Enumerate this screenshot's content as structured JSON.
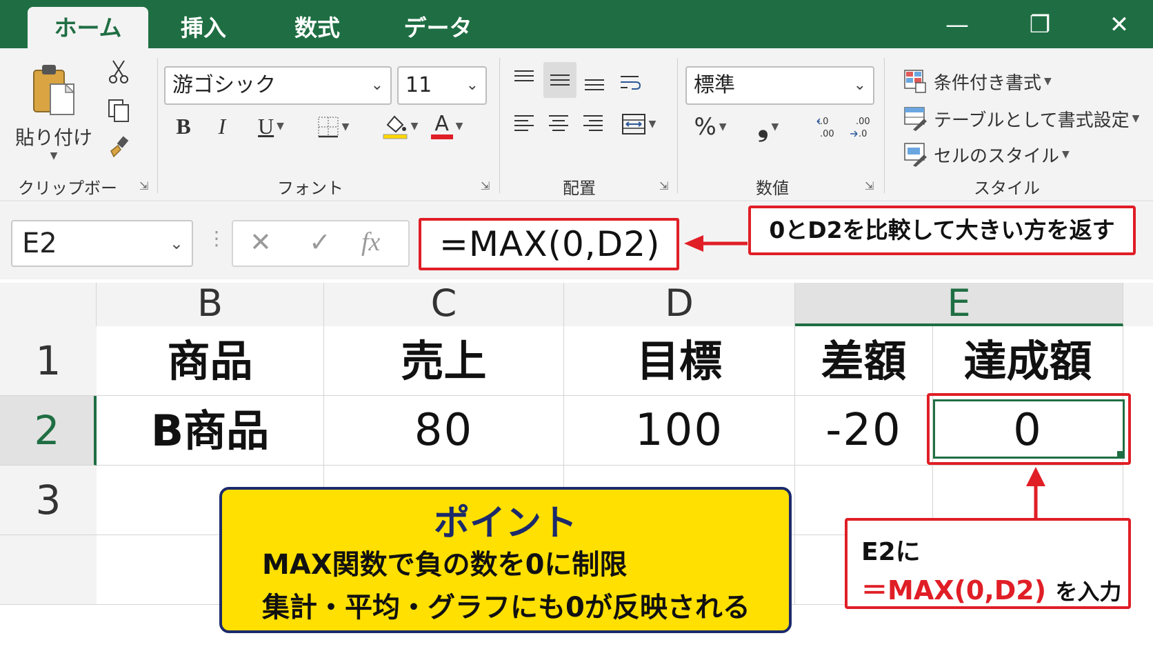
{
  "tabs": [
    {
      "label": "ホーム",
      "active": true
    },
    {
      "label": "挿入",
      "active": false
    },
    {
      "label": "数式",
      "active": false
    },
    {
      "label": "データ",
      "active": false
    }
  ],
  "window_controls": {
    "minimize": "—",
    "maximize": "❐",
    "close": "✕"
  },
  "ribbon": {
    "clipboard": {
      "label": "クリップボード",
      "paste_label": "貼り付け"
    },
    "font": {
      "label": "フォント",
      "font_name": "游ゴシック",
      "font_size": "11",
      "bold": "B",
      "italic": "I",
      "underline": "U",
      "font_color_glyph": "A"
    },
    "alignment": {
      "label": "配置"
    },
    "number": {
      "label": "数値",
      "format": "標準",
      "percent": "%",
      "comma": "❟"
    },
    "styles": {
      "label": "スタイル",
      "items": [
        "条件付き書式",
        "テーブルとして書式設定",
        "セルのスタイル"
      ]
    }
  },
  "formula_bar": {
    "name_box": "E2",
    "cancel": "✕",
    "enter": "✓",
    "fx": "fx",
    "formula": "=MAX(0,D2)",
    "callout": "0とD2を比較して大きい方を返す"
  },
  "grid": {
    "columns": [
      "B",
      "C",
      "D",
      "E"
    ],
    "selected_column": "E",
    "rows": [
      "1",
      "2",
      "3"
    ],
    "selected_row": "2",
    "header_row": [
      "商品",
      "売上",
      "目標",
      "差額",
      "達成額"
    ],
    "data_row": [
      "B商品",
      "80",
      "100",
      "-20",
      "0"
    ]
  },
  "point_box": {
    "title": "ポイント",
    "lines": [
      "MAX関数で負の数を0に制限",
      "集計・平均・グラフにも0が反映される"
    ]
  },
  "e2_callout": {
    "line1": "E2に",
    "formula": "＝MAX(0,D2)",
    "suffix": "を入力"
  },
  "colors": {
    "excel_green": "#1f6e43",
    "highlight_red": "#e01e26",
    "point_yellow": "#ffe000",
    "point_navy": "#1b2a6b"
  }
}
